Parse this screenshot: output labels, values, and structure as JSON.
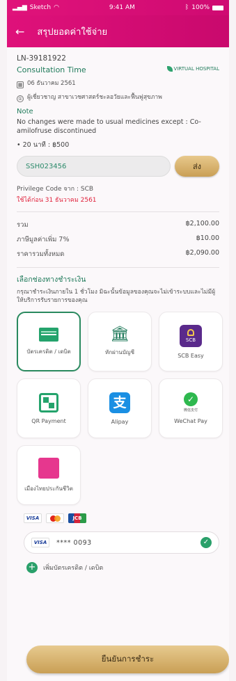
{
  "status_bar": {
    "carrier": "Sketch",
    "time": "9:41 AM",
    "battery": "100%"
  },
  "header": {
    "title": "สรุปยอดค่าใช้จ่าย"
  },
  "consult": {
    "ln": "LN-39181922",
    "type": "Consultation Time",
    "logo_text": "VIRTUAL HOSPITAL",
    "date": "06 ธันวาคม 2561",
    "doctor": "ผู้เชี่ยวชาญ สาขาเวชศาสตร์ชะลอวัยและฟื้นฟูสุขภาพ",
    "note_title": "Note",
    "note_text": "No changes were made to usual medicines except : Co-amilofruse discontinued",
    "fee": "• 20 นาที : ฿500"
  },
  "promo": {
    "code_value": "SSH023456",
    "send_label": "ส่ง"
  },
  "privilege": {
    "code": "Privilege Code จาก : SCB",
    "expiry": "ใช้ได้ก่อน 31 ธันวาคม 2561"
  },
  "summary": [
    {
      "label": "รวม",
      "value": "฿2,100.00"
    },
    {
      "label": "ภาษีมูลค่าเพิ่ม 7%",
      "value": "฿10.00"
    },
    {
      "label": "ราคารวมทั้งหมด",
      "value": "฿2,090.00"
    }
  ],
  "payment": {
    "title": "เลือกช่องทางชำระเงิน",
    "description": "กรุณาชำระเงินภายใน 1 ชั่วโมง มิฉะนั้นข้อมูลของคุณจะไม่เข้าระบบและไม่มีผู้ให้บริการรับรายการของคุณ",
    "methods": [
      {
        "label": "บัตรเครดิต / เดบิต",
        "icon": "credit-card-icon"
      },
      {
        "label": "หักผ่านบัญชี",
        "icon": "bank-icon"
      },
      {
        "label": "SCB Easy",
        "icon": "scb-icon"
      },
      {
        "label": "QR Payment",
        "icon": "qr-code-icon"
      },
      {
        "label": "Alipay",
        "icon": "alipay-icon"
      },
      {
        "label": "WeChat Pay",
        "icon": "wechat-icon"
      },
      {
        "label": "เมืองไทยประกันชีวิต",
        "icon": "muang-thai-icon"
      }
    ],
    "scb_badge": "SCB",
    "alipay_glyph": "支",
    "wechat_glyph": "微信支付",
    "card_brands": [
      "VISA",
      "MasterCard",
      "JCB"
    ],
    "saved_card": {
      "brand": "VISA",
      "number": "**** 0093"
    },
    "add_card_label": "เพิ่มบัตรเครดิต / เดบิต"
  },
  "confirm_label": "ยืนยันการชำระ",
  "colors": {
    "brand_pink": "#df117a",
    "accent_green": "#24a36c",
    "gold": "#c99f55"
  }
}
